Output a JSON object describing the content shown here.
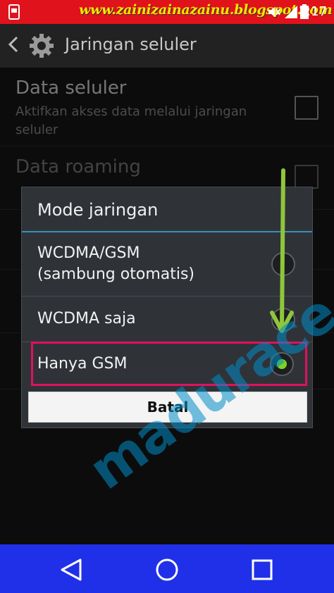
{
  "status_bar": {
    "watermark": "www.zainizainazainu.blogspot.com",
    "time": "1:17"
  },
  "action_bar": {
    "title": "Jaringan seluler"
  },
  "settings": {
    "data_seluler": {
      "title": "Data seluler",
      "subtitle_line1": "Aktifkan akses data melalui jaringan",
      "subtitle_line2": "seluler"
    },
    "data_roaming": {
      "title": "Data roaming"
    }
  },
  "dialog": {
    "title": "Mode jaringan",
    "options": [
      {
        "label_line1": "WCDMA/GSM",
        "label_line2": "(sambung otomatis)",
        "selected": false
      },
      {
        "label_line1": "WCDMA saja",
        "selected": false
      },
      {
        "label_line1": "Hanya GSM",
        "selected": true
      }
    ],
    "cancel_label": "Batal"
  },
  "watermark_diagonal": "madurace.com",
  "colors": {
    "status_bar": "#e0121b",
    "nav_bar": "#2030e8",
    "accent_green": "#7ed321",
    "highlight": "#e0115f"
  }
}
